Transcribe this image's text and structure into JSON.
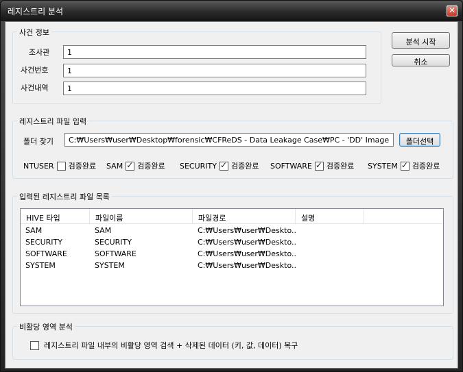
{
  "window": {
    "title": "레지스트리 분석",
    "close_glyph": "✕"
  },
  "case_info": {
    "group_label": "사건 정보",
    "fields": [
      {
        "label": "조사관",
        "value": "1"
      },
      {
        "label": "사건번호",
        "value": "1"
      },
      {
        "label": "사건내역",
        "value": "1"
      }
    ]
  },
  "actions": {
    "start_label": "분석 시작",
    "cancel_label": "취소"
  },
  "registry_input": {
    "group_label": "레지스트리 파일 입력",
    "folder_label": "폴더 찾기",
    "folder_path": "C:₩Users₩user₩Desktop₩forensic₩CFReDS - Data Leakage Case₩PC - 'DD' Image",
    "browse_label": "폴더선택",
    "checks": [
      {
        "hive": "NTUSER",
        "label": "검증완료",
        "checked": false
      },
      {
        "hive": "SAM",
        "label": "검증완료",
        "checked": true
      },
      {
        "hive": "SECURITY",
        "label": "검증완료",
        "checked": true
      },
      {
        "hive": "SOFTWARE",
        "label": "검증완료",
        "checked": true
      },
      {
        "hive": "SYSTEM",
        "label": "검증완료",
        "checked": true
      }
    ]
  },
  "file_list": {
    "group_label": "입력된 레지스트리 파일 목록",
    "columns": [
      "HIVE 타입",
      "파일이름",
      "파일경로",
      "설명"
    ],
    "rows": [
      {
        "hive": "SAM",
        "name": "SAM",
        "path": "C:₩Users₩user₩Deskto...",
        "desc": ""
      },
      {
        "hive": "SECURITY",
        "name": "SECURITY",
        "path": "C:₩Users₩user₩Deskto...",
        "desc": ""
      },
      {
        "hive": "SOFTWARE",
        "name": "SOFTWARE",
        "path": "C:₩Users₩user₩Deskto...",
        "desc": ""
      },
      {
        "hive": "SYSTEM",
        "name": "SYSTEM",
        "path": "C:₩Users₩user₩Deskto...",
        "desc": ""
      }
    ]
  },
  "unallocated": {
    "group_label": "비활당 영역 분석",
    "option_label": "레지스트리 파일 내부의 비활당 영역 검색 + 삭제된 데이터 (키, 값, 데이터) 복구",
    "checked": false
  }
}
